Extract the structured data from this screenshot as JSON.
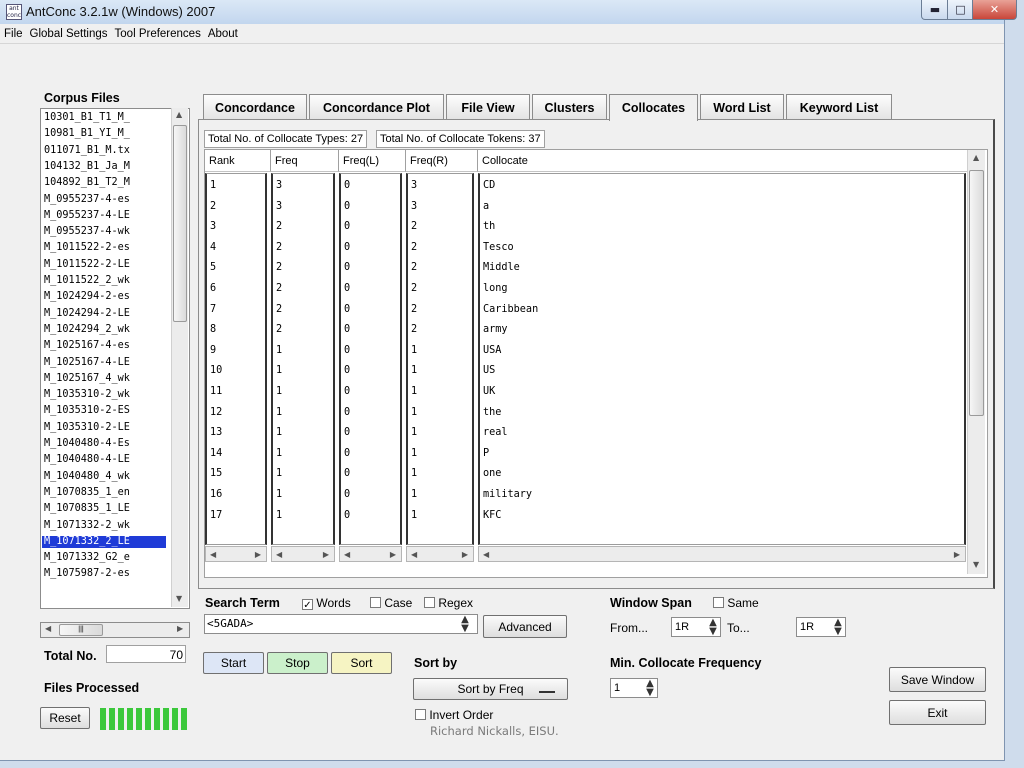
{
  "window": {
    "title": "AntConc 3.2.1w (Windows) 2007",
    "app_icon": "antconc-app-icon",
    "app_icon_text": "ant conc"
  },
  "menu": [
    "File",
    "Global Settings",
    "Tool Preferences",
    "About"
  ],
  "corpus": {
    "title": "Corpus Files",
    "files": [
      "10301_B1_T1_M_",
      "10981_B1_YI_M_",
      "011071_B1_M.tx",
      "104132_B1_Ja_M",
      "104892_B1_T2_M",
      "M_0955237-4-es",
      "M_0955237-4-LE",
      "M_0955237-4-wk",
      "M_1011522-2-es",
      "M_1011522-2-LE",
      "M_1011522_2_wk",
      "M_1024294-2-es",
      "M_1024294-2-LE",
      "M_1024294_2_wk",
      "M_1025167-4-es",
      "M_1025167-4-LE",
      "M_1025167_4_wk",
      "M_1035310-2_wk",
      "M_1035310-2-ES",
      "M_1035310-2-LE",
      "M_1040480-4-Es",
      "M_1040480-4-LE",
      "M_1040480_4_wk",
      "M_1070835_1_en",
      "M_1070835_1_LE",
      "M_1071332-2_wk",
      "M_1071332_2_LE",
      "M_1071332_G2_e",
      "M_1075987-2-es"
    ],
    "selected_index": 26,
    "total_label": "Total No.",
    "total_value": "70",
    "files_processed_label": "Files Processed",
    "reset_label": "Reset",
    "progress_fraction": 1.0
  },
  "tabs": [
    {
      "label": "Concordance",
      "active": false
    },
    {
      "label": "Concordance Plot",
      "active": false
    },
    {
      "label": "File View",
      "active": false
    },
    {
      "label": "Clusters",
      "active": false
    },
    {
      "label": "Collocates",
      "active": true
    },
    {
      "label": "Word List",
      "active": false
    },
    {
      "label": "Keyword List",
      "active": false
    }
  ],
  "info": {
    "types": "Total No. of Collocate Types: 27",
    "tokens": "Total No. of Collocate Tokens: 37"
  },
  "columns": [
    "Rank",
    "Freq",
    "Freq(L)",
    "Freq(R)",
    "Collocate"
  ],
  "rows": [
    {
      "rank": "1",
      "freq": "3",
      "freql": "0",
      "freqr": "3",
      "collocate": "CD"
    },
    {
      "rank": "2",
      "freq": "3",
      "freql": "0",
      "freqr": "3",
      "collocate": "a"
    },
    {
      "rank": "3",
      "freq": "2",
      "freql": "0",
      "freqr": "2",
      "collocate": "th"
    },
    {
      "rank": "4",
      "freq": "2",
      "freql": "0",
      "freqr": "2",
      "collocate": "Tesco"
    },
    {
      "rank": "5",
      "freq": "2",
      "freql": "0",
      "freqr": "2",
      "collocate": "Middle"
    },
    {
      "rank": "6",
      "freq": "2",
      "freql": "0",
      "freqr": "2",
      "collocate": "long"
    },
    {
      "rank": "7",
      "freq": "2",
      "freql": "0",
      "freqr": "2",
      "collocate": "Caribbean"
    },
    {
      "rank": "8",
      "freq": "2",
      "freql": "0",
      "freqr": "2",
      "collocate": "army"
    },
    {
      "rank": "9",
      "freq": "1",
      "freql": "0",
      "freqr": "1",
      "collocate": "USA"
    },
    {
      "rank": "10",
      "freq": "1",
      "freql": "0",
      "freqr": "1",
      "collocate": "US"
    },
    {
      "rank": "11",
      "freq": "1",
      "freql": "0",
      "freqr": "1",
      "collocate": "UK"
    },
    {
      "rank": "12",
      "freq": "1",
      "freql": "0",
      "freqr": "1",
      "collocate": "the"
    },
    {
      "rank": "13",
      "freq": "1",
      "freql": "0",
      "freqr": "1",
      "collocate": "real"
    },
    {
      "rank": "14",
      "freq": "1",
      "freql": "0",
      "freqr": "1",
      "collocate": "P"
    },
    {
      "rank": "15",
      "freq": "1",
      "freql": "0",
      "freqr": "1",
      "collocate": "one"
    },
    {
      "rank": "16",
      "freq": "1",
      "freql": "0",
      "freqr": "1",
      "collocate": "military"
    },
    {
      "rank": "17",
      "freq": "1",
      "freql": "0",
      "freqr": "1",
      "collocate": "KFC"
    }
  ],
  "search": {
    "label": "Search Term",
    "words_label": "Words",
    "words_checked": true,
    "case_label": "Case",
    "case_checked": false,
    "regex_label": "Regex",
    "regex_checked": false,
    "value": "<5GADA>",
    "advanced_label": "Advanced"
  },
  "buttons": {
    "start": "Start",
    "stop": "Stop",
    "sort": "Sort"
  },
  "sort": {
    "label": "Sort by",
    "selected": "Sort by Freq",
    "invert_label": "Invert Order",
    "invert_checked": false
  },
  "window_span": {
    "label": "Window Span",
    "same_label": "Same",
    "same_checked": false,
    "from_label": "From...",
    "from_value": "1R",
    "to_label": "To...",
    "to_value": "1R"
  },
  "min_freq": {
    "label": "Min. Collocate Frequency",
    "value": "1"
  },
  "actions": {
    "save_window": "Save Window",
    "exit": "Exit"
  },
  "credit": "Richard Nickalls, EISU."
}
